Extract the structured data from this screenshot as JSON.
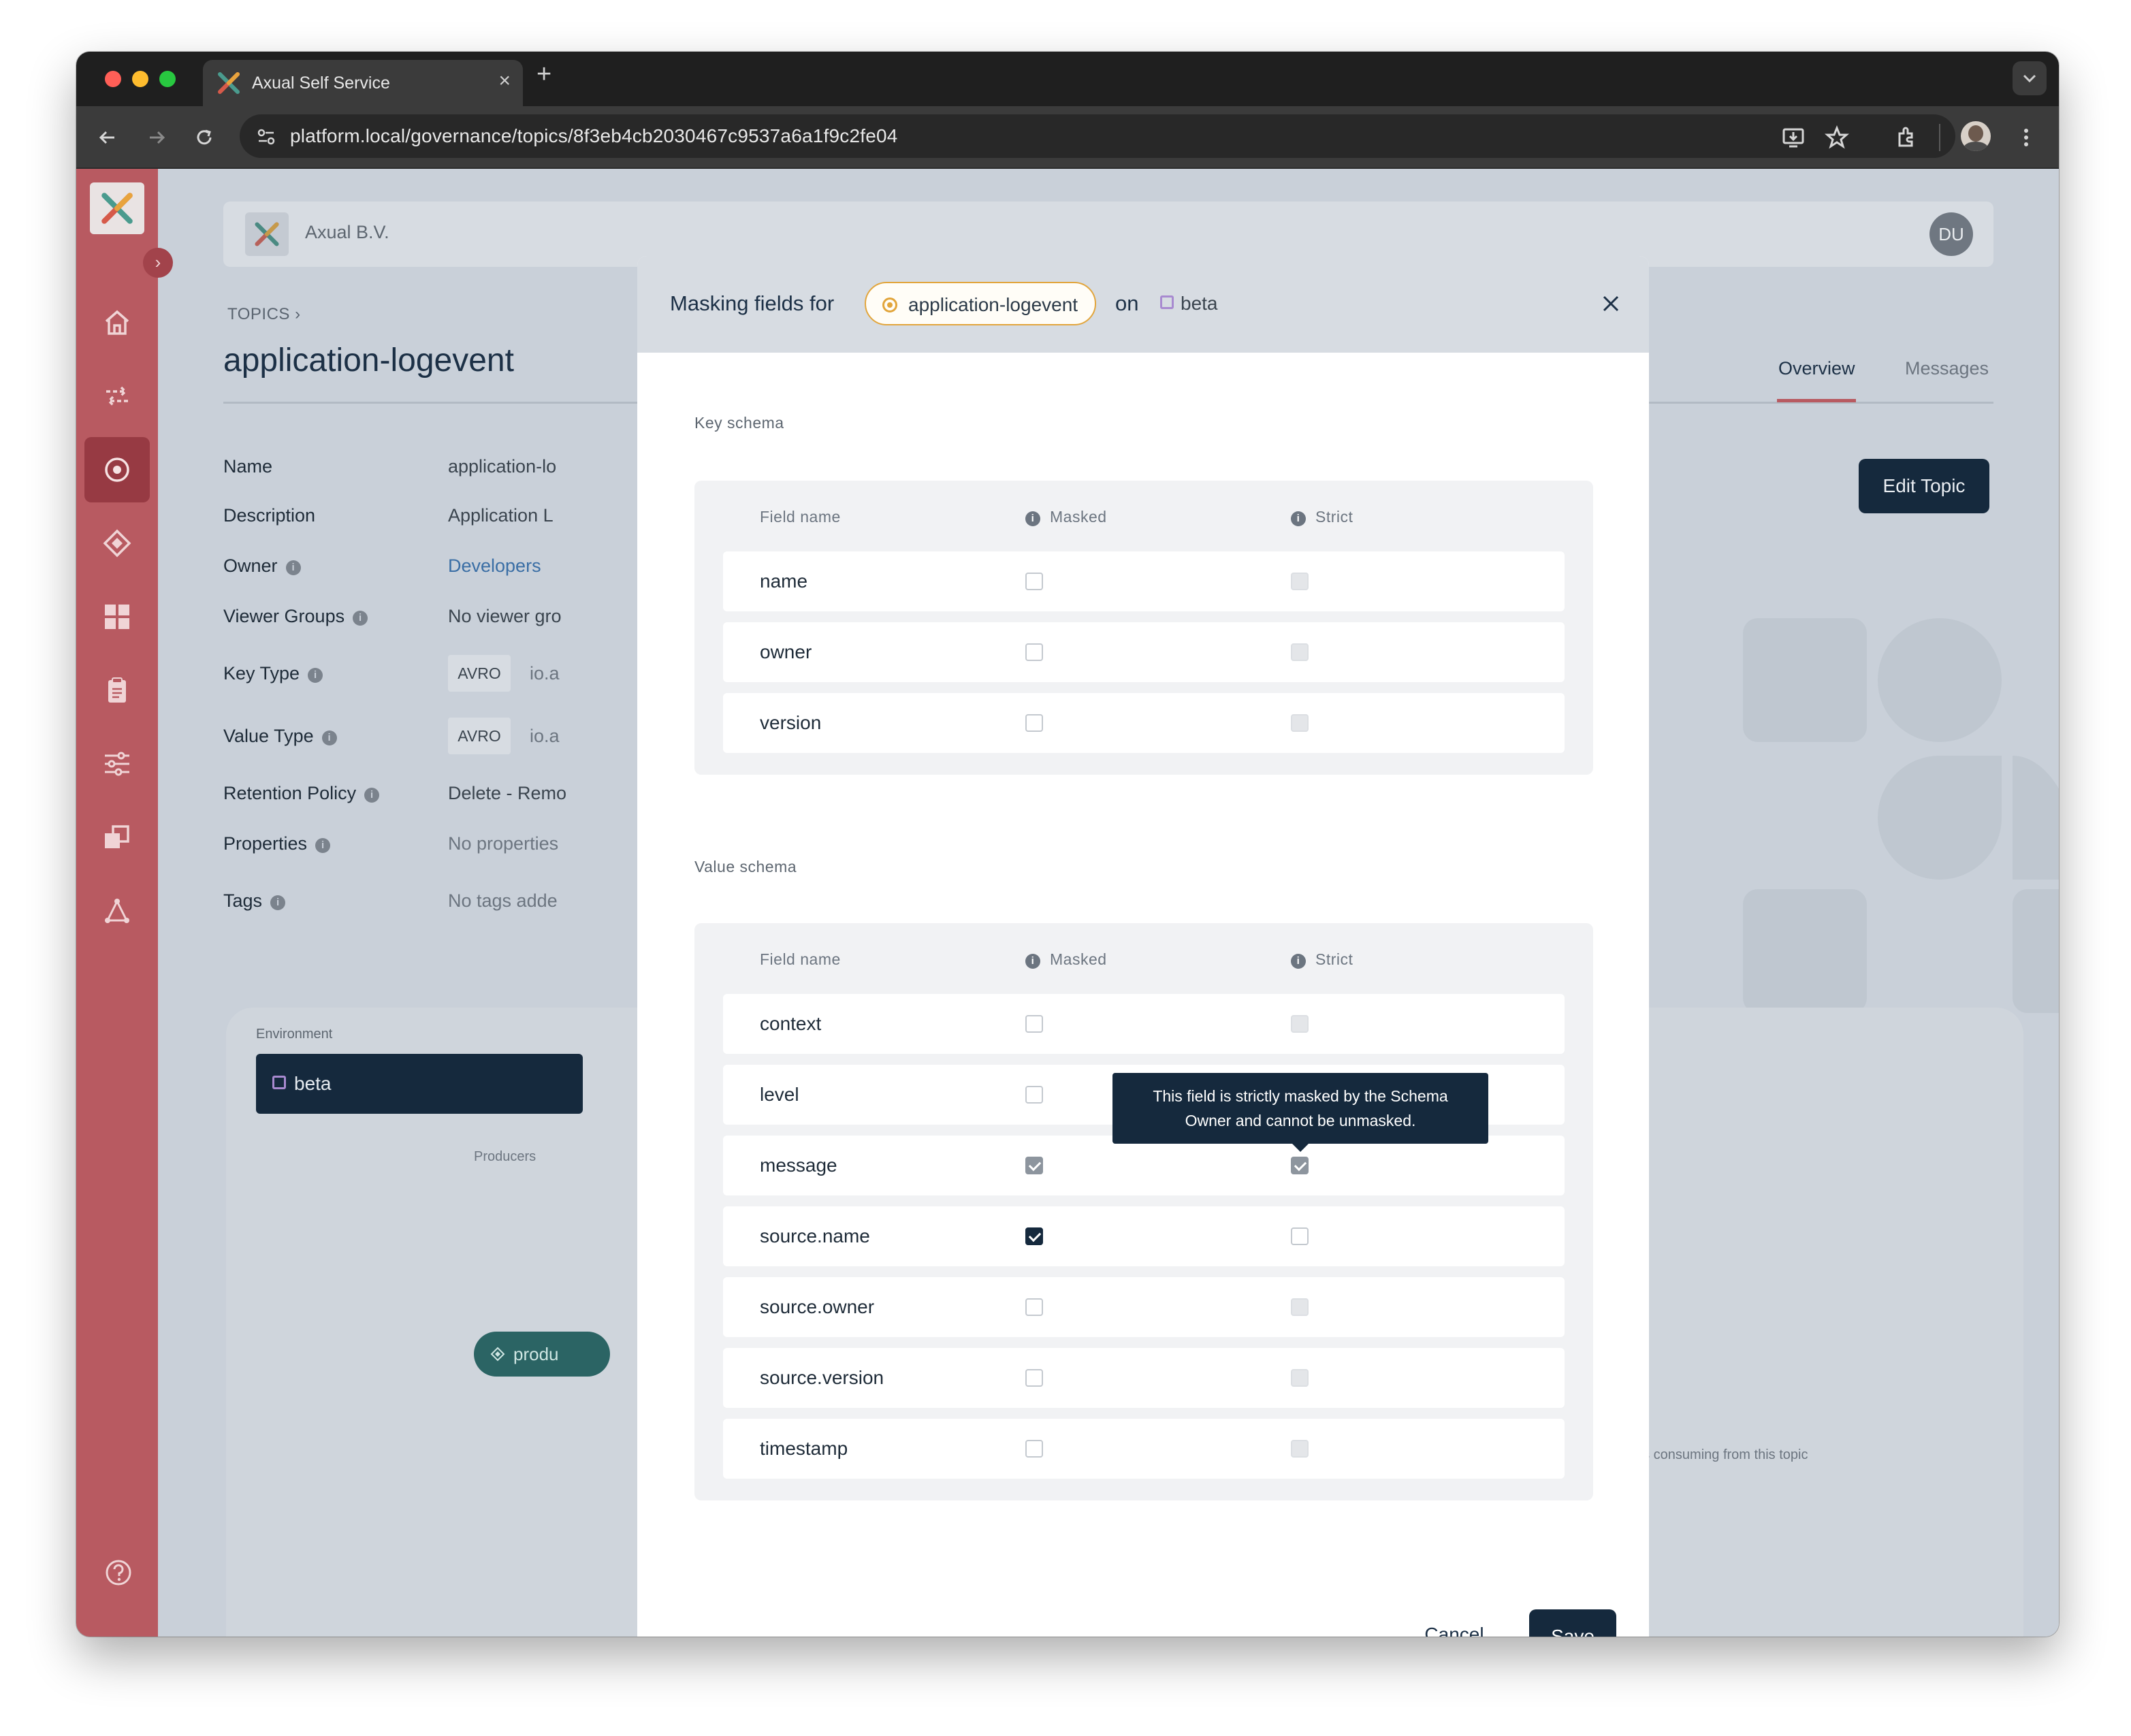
{
  "browser": {
    "tab_title": "Axual Self Service",
    "url": "platform.local/governance/topics/8f3eb4cb2030467c9537a6a1f9c2fe04"
  },
  "header": {
    "org_name": "Axual B.V.",
    "avatar_initials": "DU"
  },
  "page": {
    "breadcrumb": "TOPICS",
    "title": "application-logevent",
    "tabs": [
      "Overview",
      "Messages"
    ],
    "edit_button": "Edit Topic"
  },
  "details": {
    "name_label": "Name",
    "name_value": "application-lo",
    "description_label": "Description",
    "description_value": "Application L",
    "owner_label": "Owner",
    "owner_value": "Developers",
    "viewer_groups_label": "Viewer Groups",
    "viewer_groups_value": "No viewer gro",
    "key_type_label": "Key Type",
    "key_type_badge": "AVRO",
    "key_type_value": "io.a",
    "value_type_label": "Value Type",
    "value_type_badge": "AVRO",
    "value_type_value": "io.a",
    "retention_label": "Retention Policy",
    "retention_value": "Delete - Remo",
    "properties_label": "Properties",
    "properties_value": "No properties",
    "tags_label": "Tags",
    "tags_value": "No tags adde"
  },
  "environment_panel": {
    "label": "Environment",
    "selected": "beta",
    "producers_label": "Producers",
    "producer_pill": "produ",
    "consumer_text": "n is consuming from this topic"
  },
  "modal": {
    "title_prefix": "Masking fields for",
    "topic": "application-logevent",
    "on_word": "on",
    "environment": "beta",
    "key_schema": {
      "label": "Key schema",
      "headers": {
        "field": "Field name",
        "masked": "Masked",
        "strict": "Strict"
      },
      "rows": [
        {
          "field": "name",
          "masked": false,
          "strict": false
        },
        {
          "field": "owner",
          "masked": false,
          "strict": false
        },
        {
          "field": "version",
          "masked": false,
          "strict": false
        }
      ]
    },
    "value_schema": {
      "label": "Value schema",
      "headers": {
        "field": "Field name",
        "masked": "Masked",
        "strict": "Strict"
      },
      "rows": [
        {
          "field": "context",
          "masked": false,
          "strict": false
        },
        {
          "field": "level",
          "masked": false,
          "strict": false
        },
        {
          "field": "message",
          "masked": true,
          "strict": true
        },
        {
          "field": "source.name",
          "masked": true,
          "strict": false
        },
        {
          "field": "source.owner",
          "masked": false,
          "strict": false
        },
        {
          "field": "source.version",
          "masked": false,
          "strict": false
        },
        {
          "field": "timestamp",
          "masked": false,
          "strict": false
        }
      ]
    },
    "tooltip_line1": "This field is strictly masked by the Schema",
    "tooltip_line2": "Owner and cannot be unmasked.",
    "cancel_label": "Cancel",
    "save_label": "Save"
  },
  "colors": {
    "sidebar": "#b85a61",
    "primary": "#15293d",
    "topic_pill_border": "#e2a53b",
    "env_square": "#a88ad0"
  }
}
